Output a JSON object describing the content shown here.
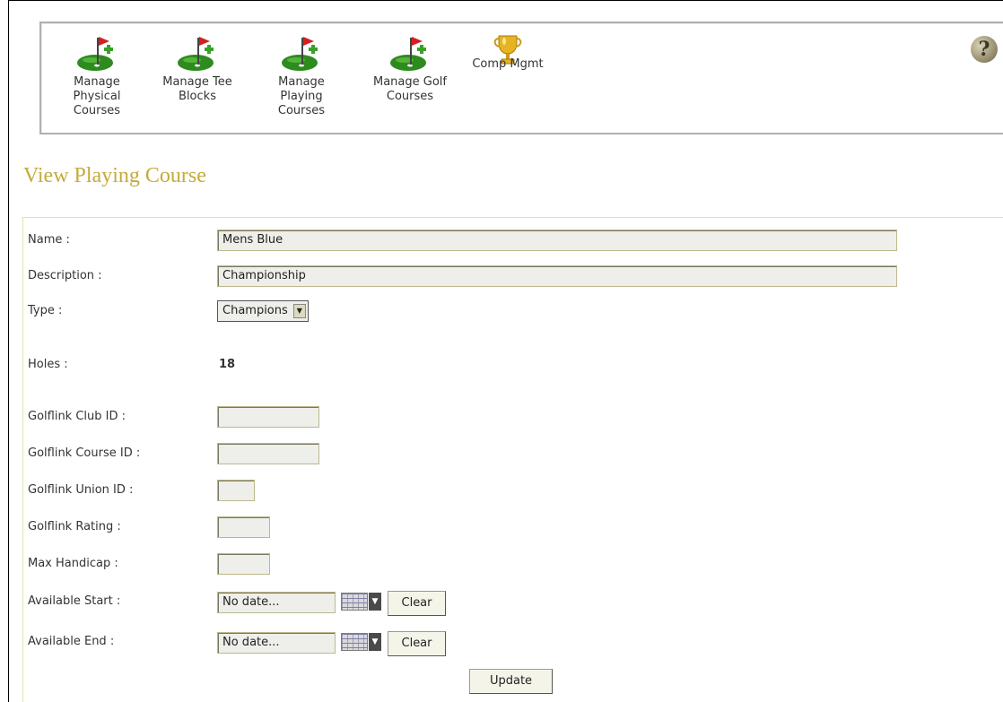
{
  "toolbar": {
    "items": [
      {
        "label": "Manage Physical Courses",
        "icon": "golf-flag-add-icon"
      },
      {
        "label": "Manage Tee Blocks",
        "icon": "golf-flag-add-icon"
      },
      {
        "label": "Manage Playing Courses",
        "icon": "golf-flag-add-icon"
      },
      {
        "label": "Manage Golf Courses",
        "icon": "golf-flag-add-icon"
      },
      {
        "label": "Comp Mgmt",
        "icon": "trophy-icon"
      }
    ],
    "help_label": "?"
  },
  "page": {
    "title": "View Playing Course"
  },
  "form": {
    "name": {
      "label": "Name :",
      "value": "Mens Blue"
    },
    "description": {
      "label": "Description :",
      "value": "Championship"
    },
    "type": {
      "label": "Type :",
      "selected": "Champions"
    },
    "holes": {
      "label": "Holes :",
      "value": "18"
    },
    "golflink_club_id": {
      "label": "Golflink Club ID :",
      "value": ""
    },
    "golflink_course_id": {
      "label": "Golflink Course ID :",
      "value": ""
    },
    "golflink_union_id": {
      "label": "Golflink Union ID :",
      "value": ""
    },
    "golflink_rating": {
      "label": "Golflink Rating :",
      "value": ""
    },
    "max_handicap": {
      "label": "Max Handicap :",
      "value": ""
    },
    "available_start": {
      "label": "Available Start :",
      "value": "No date...",
      "clear_label": "Clear"
    },
    "available_end": {
      "label": "Available End :",
      "value": "No date...",
      "clear_label": "Clear"
    },
    "update_label": "Update"
  },
  "colors": {
    "title": "#c4ab3a",
    "panel_border": "#e3dfb7",
    "field_bg": "#eeeeea",
    "green": "#2e8b1f",
    "flag_red": "#d42020"
  }
}
